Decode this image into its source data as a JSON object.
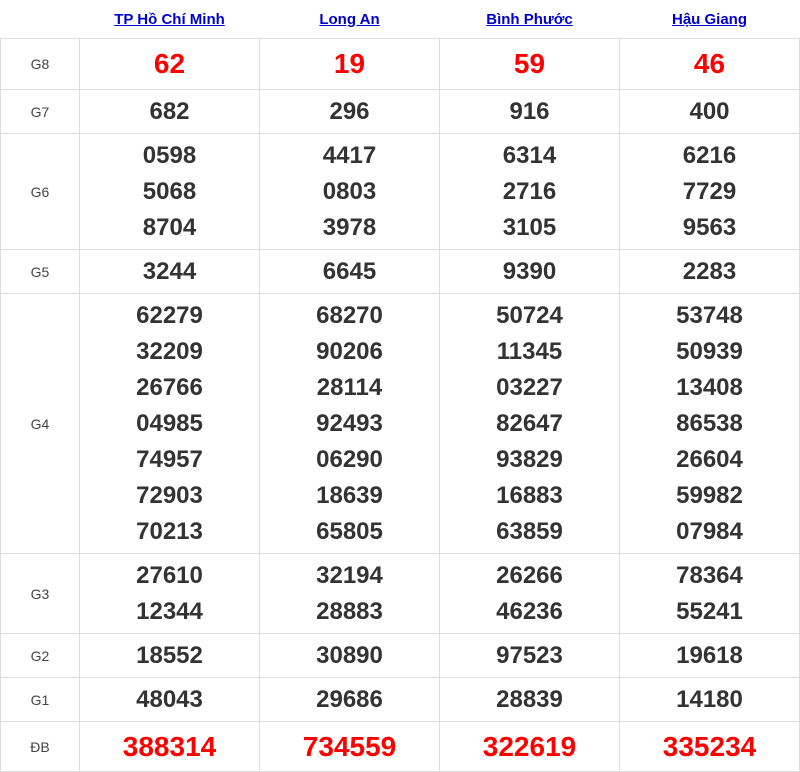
{
  "provinces": [
    "TP Hồ Chí Minh",
    "Long An",
    "Bình Phước",
    "Hậu Giang"
  ],
  "rows": [
    {
      "prize": "G8",
      "values": [
        [
          "62"
        ],
        [
          "19"
        ],
        [
          "59"
        ],
        [
          "46"
        ]
      ]
    },
    {
      "prize": "G7",
      "values": [
        [
          "682"
        ],
        [
          "296"
        ],
        [
          "916"
        ],
        [
          "400"
        ]
      ]
    },
    {
      "prize": "G6",
      "values": [
        [
          "0598",
          "5068",
          "8704"
        ],
        [
          "4417",
          "0803",
          "3978"
        ],
        [
          "6314",
          "2716",
          "3105"
        ],
        [
          "6216",
          "7729",
          "9563"
        ]
      ]
    },
    {
      "prize": "G5",
      "values": [
        [
          "3244"
        ],
        [
          "6645"
        ],
        [
          "9390"
        ],
        [
          "2283"
        ]
      ]
    },
    {
      "prize": "G4",
      "values": [
        [
          "62279",
          "32209",
          "26766",
          "04985",
          "74957",
          "72903",
          "70213"
        ],
        [
          "68270",
          "90206",
          "28114",
          "92493",
          "06290",
          "18639",
          "65805"
        ],
        [
          "50724",
          "11345",
          "03227",
          "82647",
          "93829",
          "16883",
          "63859"
        ],
        [
          "53748",
          "50939",
          "13408",
          "86538",
          "26604",
          "59982",
          "07984"
        ]
      ]
    },
    {
      "prize": "G3",
      "values": [
        [
          "27610",
          "12344"
        ],
        [
          "32194",
          "28883"
        ],
        [
          "26266",
          "46236"
        ],
        [
          "78364",
          "55241"
        ]
      ]
    },
    {
      "prize": "G2",
      "values": [
        [
          "18552"
        ],
        [
          "30890"
        ],
        [
          "97523"
        ],
        [
          "19618"
        ]
      ]
    },
    {
      "prize": "G1",
      "values": [
        [
          "48043"
        ],
        [
          "29686"
        ],
        [
          "28839"
        ],
        [
          "14180"
        ]
      ]
    },
    {
      "prize": "ĐB",
      "values": [
        [
          "388314"
        ],
        [
          "734559"
        ],
        [
          "322619"
        ],
        [
          "335234"
        ]
      ]
    }
  ],
  "colors": {
    "link": "#0000cc",
    "highlight": "#ff0000",
    "number": "#333333"
  }
}
